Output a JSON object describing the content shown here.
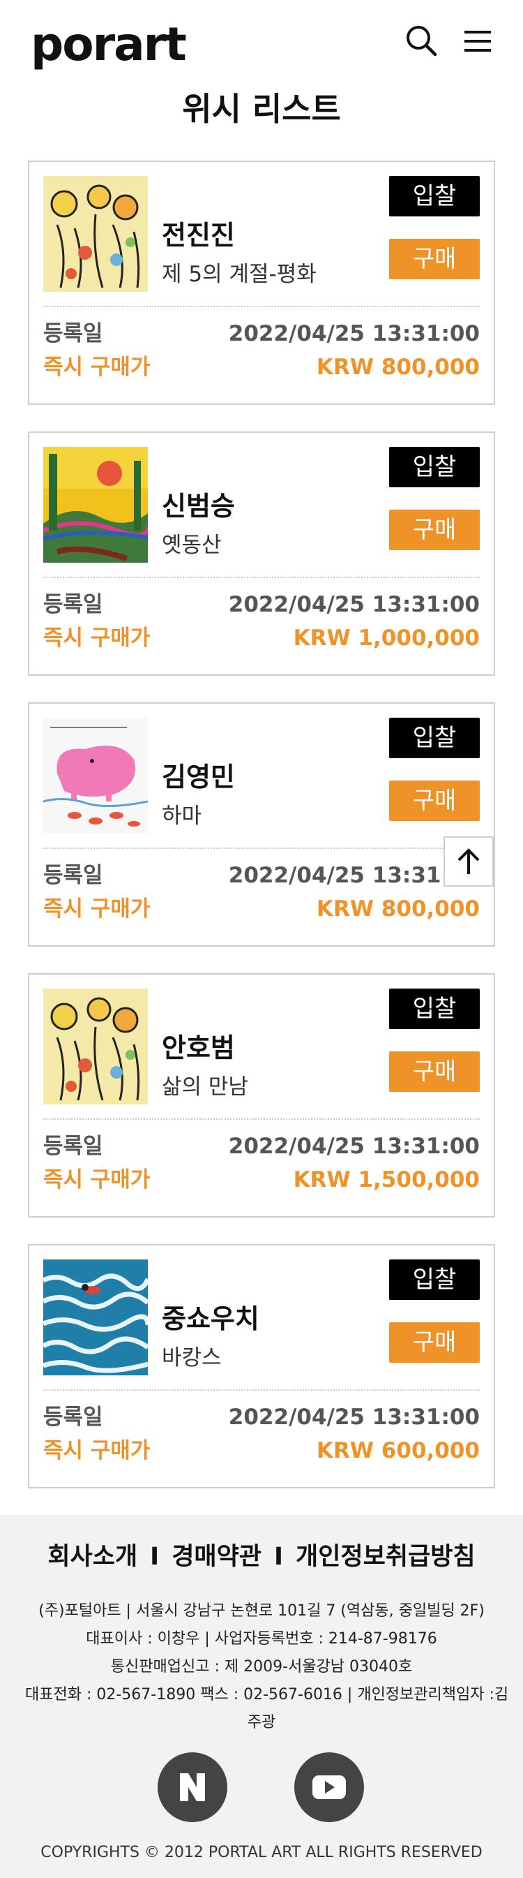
{
  "header": {
    "logo": "porart",
    "icons": [
      "search-icon",
      "menu-icon"
    ]
  },
  "page_title": "위시 리스트",
  "labels": {
    "bid": "입찰",
    "buy": "구매",
    "registered": "등록일",
    "instant_price": "즉시 구매가"
  },
  "items": [
    {
      "artist": "전진진",
      "title": "제 5의 계절-평화",
      "date": "2022/04/25 13:31:00",
      "price": "KRW 800,000"
    },
    {
      "artist": "신범승",
      "title": "옛동산",
      "date": "2022/04/25 13:31:00",
      "price": "KRW 1,000,000"
    },
    {
      "artist": "김영민",
      "title": "하마",
      "date": "2022/04/25 13:31:00",
      "price": "KRW 800,000"
    },
    {
      "artist": "안호범",
      "title": "삶의 만남",
      "date": "2022/04/25 13:31:00",
      "price": "KRW 1,500,000"
    },
    {
      "artist": "중쇼우치",
      "title": "바캉스",
      "date": "2022/04/25 13:31:00",
      "price": "KRW 600,000"
    }
  ],
  "colors": {
    "accent": "#ef9329",
    "bid_button": "#000000",
    "footer_bg": "#f2f2f2"
  },
  "footer": {
    "links": [
      "회사소개",
      "경매약관",
      "개인정보취급방침"
    ],
    "separator": "I",
    "info": [
      "(주)포털아트  |  서울시 강남구 논현로 101길 7 (역삼동, 중일빌딩 2F)",
      "대표이사 : 이창우  |  사업자등록번호 : 214-87-98176",
      "통신판매업신고 : 제 2009-서울강남 03040호",
      "대표전화 : 02-567-1890 팩스 : 02-567-6016  |  개인정보관리책임자 :김",
      "주광"
    ],
    "social": [
      "naver-icon",
      "youtube-icon"
    ],
    "copyright": "COPYRIGHTS © 2012 PORTAL ART ALL RIGHTS RESERVED"
  }
}
